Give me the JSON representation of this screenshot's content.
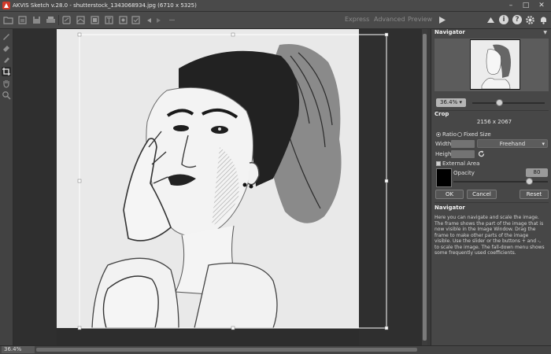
{
  "titlebar": {
    "title": "AKVIS Sketch v.28.0 - shutterstock_1343068934.jpg (6710 x 5325)",
    "minimize": "–",
    "maximize": "□",
    "close": "✕"
  },
  "toolbar": {
    "modes": [
      "Express",
      "Advanced",
      "Preview"
    ],
    "help_icons": [
      "i",
      "?"
    ]
  },
  "status": {
    "zoom": "36.4%"
  },
  "navigator": {
    "header": "Navigator",
    "zoom": "36.4%",
    "zoom_slider_value": 0.37
  },
  "crop": {
    "header": "Crop",
    "size": "2156 x 2067",
    "ratio_label": "Ratio",
    "fixed_size_label": "Fixed Size",
    "width_label": "Width",
    "height_label": "Height",
    "mode": "Freehand",
    "external_area_label": "External Area",
    "opacity_label": "Opacity",
    "opacity": "80",
    "opacity_value": 0.8,
    "area_color": "#000000"
  },
  "buttons": {
    "ok": "OK",
    "cancel": "Cancel",
    "reset": "Reset"
  },
  "help": {
    "title": "Navigator",
    "text": "Here you can navigate and scale the image. The frame shows the part of the image that is now visible in the Image Window. Drag the frame to make other parts of the image visible. Use the slider or the buttons + and -, to scale the image. The fall-down menu shows some frequently used coefficients."
  }
}
